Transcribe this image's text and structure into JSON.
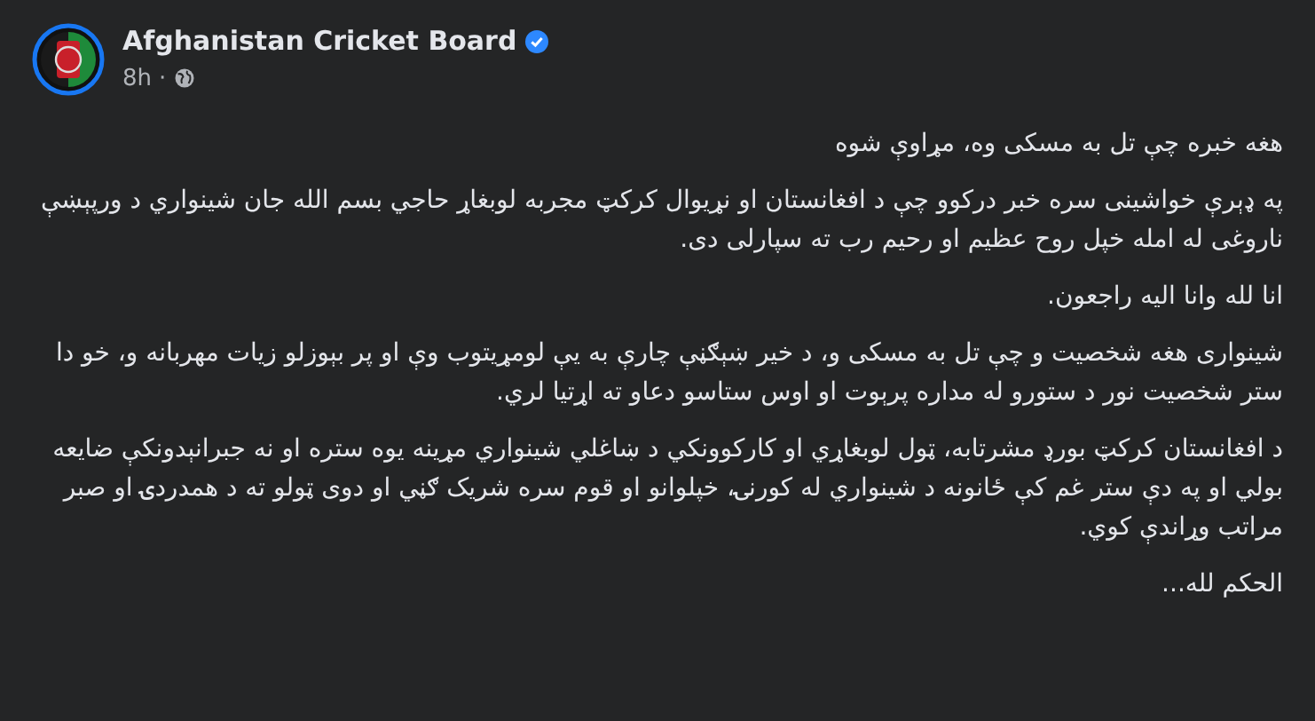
{
  "post": {
    "author": "Afghanistan Cricket Board",
    "verified": true,
    "time": "8h",
    "separator": "·",
    "paragraphs": [
      "هغه خبره چې تل به مسکی وه، مړاوې شوه",
      "په ډېرې خواشینی سره خبر درکوو چې د افغانستان او نړیوال کرکټ مجربه لوبغاړ حاجي بسم الله جان شینواري د ورپېښې ناروغی له امله خپل روح عظیم او رحیم رب ته سپارلی دی.",
      "انا لله وانا الیه راجعون.",
      "شینواری هغه شخصیت و چې تل به مسکی و، د خیر ښېګڼې چارې به یې لومړیتوب وې او پر بېوزلو زیات مهربانه و، خو دا ستر شخصیت نور د ستورو له مداره پرېوت او اوس ستاسو دعاو ته اړتیا لري.",
      "د افغانستان کرکټ بورډ مشرتابه، ټول لوبغاړي او کارکوونکي د ښاغلي شینواري مړینه یوه ستره او نه جبرانېدونکې ضایعه بولي او په دې ستر غم کې ځانونه د شینواري له کورنۍ، خپلوانو او قوم سره شریک ګڼي او دوی ټولو ته د همدردۍ او صبر مراتب وړاندې کوي.",
      "الحکم لله..."
    ]
  }
}
